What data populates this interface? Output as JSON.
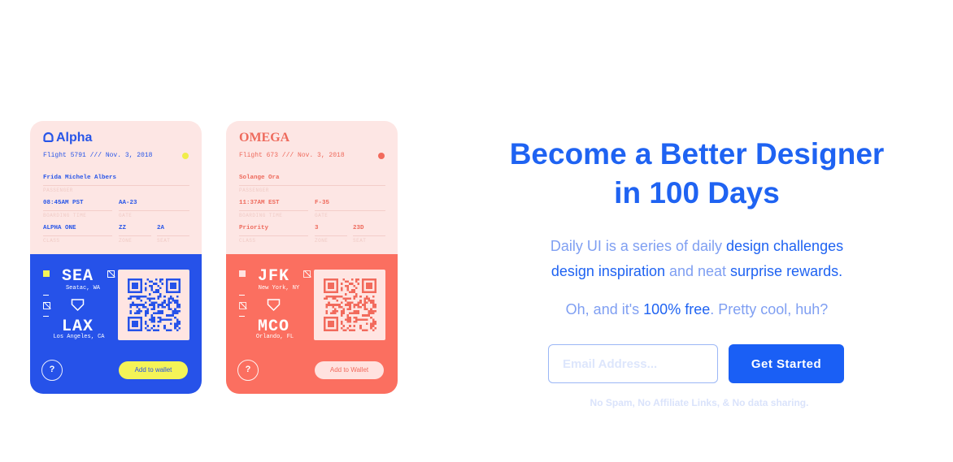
{
  "hero": {
    "title_line1": "Become a Better Designer",
    "title_line2": "in 100 Days",
    "desc": {
      "p1": "Daily UI is a series of daily ",
      "h1": "design challenges",
      "p2": " ",
      "h2": "design inspiration",
      "p3": " and neat ",
      "h3": "surprise rewards",
      "p4": "."
    },
    "free": {
      "p1": "Oh, and it's ",
      "h1": "100% free",
      "p2": ". Pretty cool, huh?"
    },
    "email_placeholder": "Email Address...",
    "cta_label": "Get Started",
    "fine_print": "No Spam, No Affiliate Links, & No data sharing."
  },
  "passes": [
    {
      "brand": "Alpha",
      "flight": "Flight 5791 /// Nov. 3, 2018",
      "passenger": "Frida Michele Albers",
      "passenger_label": "PASSENGER",
      "boarding_time": "08:45AM PST",
      "boarding_time_label": "BOARDING TIME",
      "gate": "AA-23",
      "gate_label": "GATE",
      "class": "ALPHA ONE",
      "class_label": "CLASS",
      "zone": "ZZ",
      "zone_label": "ZONE",
      "seat": "2A",
      "seat_label": "SEAT",
      "from_code": "SEA",
      "from_city": "Seatac, WA",
      "to_code": "LAX",
      "to_city": "Los Angeles, CA",
      "help": "?",
      "wallet": "Add to wallet",
      "colors": {
        "text": "#2755e8",
        "bottom": "#2652e9",
        "dot": "#f0ed4a",
        "wallet_bg": "#f4f457",
        "wallet_text": "#2652e9",
        "qr": "#2652e9"
      }
    },
    {
      "brand": "OMEGA",
      "flight": "Flight 673 /// Nov. 3, 2018",
      "passenger": "Solange Ora",
      "passenger_label": "PASSENGER",
      "boarding_time": "11:37AM EST",
      "boarding_time_label": "BOARDING TIME",
      "gate": "F-35",
      "gate_label": "GATE",
      "class": "Priority",
      "class_label": "CLASS",
      "zone": "3",
      "zone_label": "ZONE",
      "seat": "23D",
      "seat_label": "SEAT",
      "from_code": "JFK",
      "from_city": "New York, NY",
      "to_code": "MCO",
      "to_city": "Orlando, FL",
      "help": "?",
      "wallet": "Add to Wallet",
      "colors": {
        "text": "#ee6a5c",
        "bottom": "#fb6f60",
        "dot": "#f26a5c",
        "wallet_bg": "#ffe2df",
        "wallet_text": "#f26a5c",
        "qr": "#f26a5c"
      }
    }
  ]
}
